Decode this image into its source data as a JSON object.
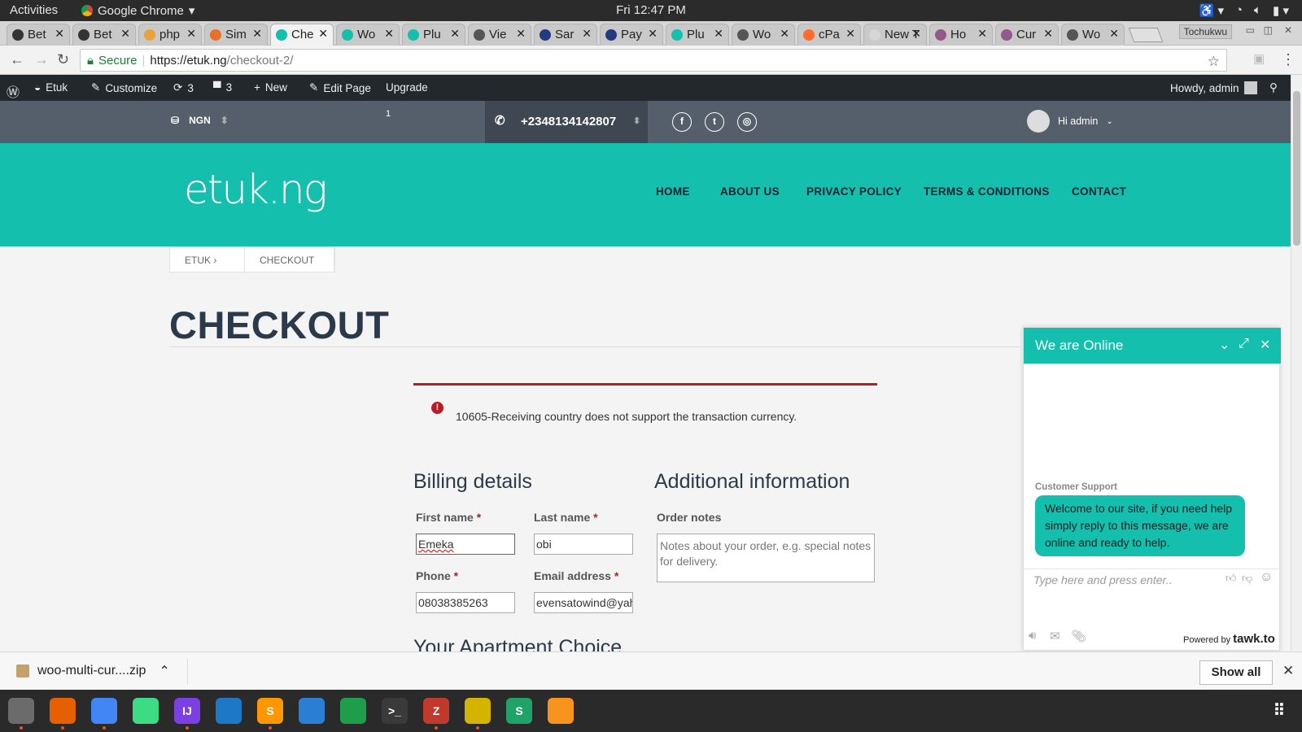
{
  "system": {
    "activities": "Activities",
    "app_name": "Google Chrome",
    "clock": "Fri 12:47 PM"
  },
  "browser": {
    "tabs": [
      {
        "label": "Bet",
        "color": "#333333"
      },
      {
        "label": "Bet",
        "color": "#333333"
      },
      {
        "label": "php",
        "color": "#e8a33d"
      },
      {
        "label": "Sim",
        "color": "#e8702a"
      },
      {
        "label": "Che",
        "color": "#14bfae",
        "active": true
      },
      {
        "label": "Wo",
        "color": "#14bfae"
      },
      {
        "label": "Plu",
        "color": "#14bfae"
      },
      {
        "label": "Vie",
        "color": "#555555"
      },
      {
        "label": "Sar",
        "color": "#253b80"
      },
      {
        "label": "Pay",
        "color": "#253b80"
      },
      {
        "label": "Plu",
        "color": "#14bfae"
      },
      {
        "label": "Wo",
        "color": "#555555"
      },
      {
        "label": "cPa",
        "color": "#ff6c2c"
      },
      {
        "label": "New T",
        "color": "#d6d6d6"
      },
      {
        "label": "Ho",
        "color": "#96588a"
      },
      {
        "label": "Cur",
        "color": "#96588a"
      },
      {
        "label": "Wo",
        "color": "#555555"
      }
    ],
    "profile": "Tochukwu",
    "secure_label": "Secure",
    "url_host": "https://etuk.ng",
    "url_path": "/checkout-2/"
  },
  "wpadmin": {
    "site": "Etuk",
    "customize": "Customize",
    "updates": "3",
    "comments": "3",
    "new": "New",
    "edit_page": "Edit Page",
    "upgrade": "Upgrade",
    "howdy": "Howdy, admin"
  },
  "site": {
    "currency": "NGN",
    "cart_count": "1",
    "phone": "+2348134142807",
    "user_greeting": "Hi admin",
    "logo": "etuk.ng",
    "menu": [
      "HOME",
      "ABOUT US",
      "PRIVACY POLICY",
      "TERMS & CONDITIONS",
      "CONTACT"
    ],
    "breadcrumb": [
      "ETUK",
      "CHECKOUT"
    ],
    "page_title": "CHECKOUT"
  },
  "checkout": {
    "error": "10605-Receiving country does not support the transaction currency.",
    "billing_heading": "Billing details",
    "additional_heading": "Additional information",
    "first_name_label": "First name",
    "last_name_label": "Last name",
    "phone_label": "Phone",
    "email_label": "Email address",
    "order_notes_label": "Order notes",
    "required_mark": "*",
    "first_name": "Emeka",
    "last_name": "obi",
    "phone": "08038385263",
    "email": "evensatowind@yah",
    "notes_placeholder": "Notes about your order, e.g. special notes for delivery.",
    "next_section": "Your Apartment Choice"
  },
  "chat": {
    "title": "We are Online",
    "agent": "Customer Support",
    "message": "Welcome to our site, if you need help simply reply to this message, we are online and ready to help.",
    "input_placeholder": "Type here and press enter..",
    "powered_prefix": "Powered by",
    "powered_brand": "tawk.to"
  },
  "downloads": {
    "file": "woo-multi-cur....zip",
    "show_all": "Show all"
  },
  "dock": [
    {
      "name": "files",
      "color": "#6b6b6b",
      "glyph": ""
    },
    {
      "name": "firefox",
      "color": "#e66000",
      "glyph": ""
    },
    {
      "name": "chrome",
      "color": "#4285f4",
      "glyph": ""
    },
    {
      "name": "android-studio",
      "color": "#3ddc84",
      "glyph": ""
    },
    {
      "name": "intellij",
      "color": "#7b3fe4",
      "glyph": "IJ"
    },
    {
      "name": "vscode",
      "color": "#1e78c8",
      "glyph": ""
    },
    {
      "name": "sublime",
      "color": "#ff9800",
      "glyph": "S"
    },
    {
      "name": "writer",
      "color": "#2a7fd4",
      "glyph": ""
    },
    {
      "name": "calc",
      "color": "#1e9e4a",
      "glyph": ""
    },
    {
      "name": "terminal",
      "color": "#3a3a3a",
      "glyph": ">_"
    },
    {
      "name": "filezilla",
      "color": "#c0392b",
      "glyph": "Z"
    },
    {
      "name": "rhythmbox",
      "color": "#d4b400",
      "glyph": ""
    },
    {
      "name": "sheets",
      "color": "#20a366",
      "glyph": "S"
    },
    {
      "name": "vlc",
      "color": "#f7941d",
      "glyph": ""
    }
  ]
}
